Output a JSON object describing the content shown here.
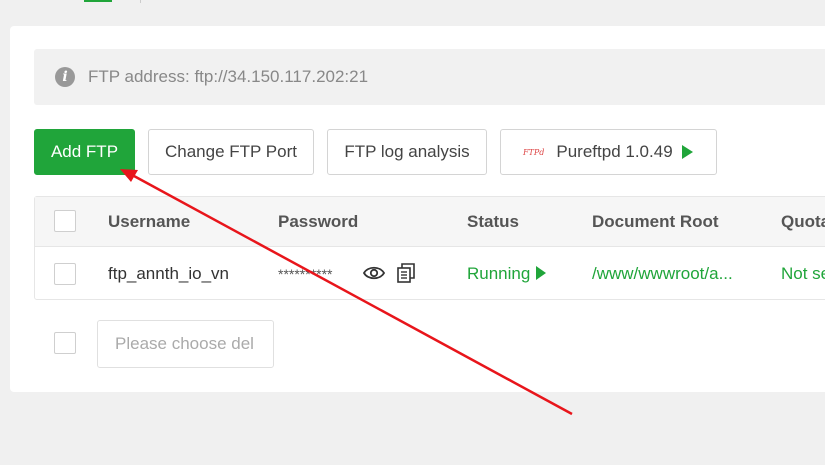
{
  "info": {
    "text": "FTP address: ftp://34.150.117.202:21",
    "icon": "info-icon"
  },
  "toolbar": {
    "add_label": "Add FTP",
    "port_label": "Change FTP Port",
    "log_label": "FTP log analysis",
    "pure_logo": "FTPd",
    "pure_label": "Pureftpd 1.0.49"
  },
  "table": {
    "headers": {
      "username": "Username",
      "password": "Password",
      "status": "Status",
      "root": "Document Root",
      "quota": "Quota"
    },
    "rows": [
      {
        "username": "ftp_annth_io_vn",
        "password": "**********",
        "status": "Running",
        "root": "/www/wwwroot/a...",
        "quota": "Not se"
      }
    ]
  },
  "bulk": {
    "placeholder": "Please choose del"
  },
  "colors": {
    "accent": "#20a53a",
    "annotation": "#e8151b"
  }
}
